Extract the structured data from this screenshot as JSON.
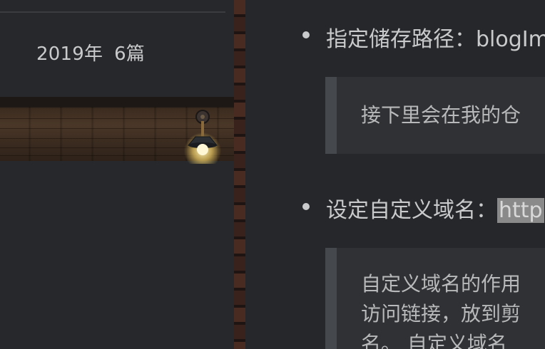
{
  "sidebar": {
    "archive": {
      "year_label": "2019年",
      "count_label": "6篇"
    }
  },
  "main": {
    "list_items": [
      {
        "label": "指定储存路径：",
        "value": "blogIm"
      },
      {
        "label": "设定自定义域名：",
        "value": "http"
      }
    ],
    "quotes": [
      {
        "lines": [
          "接下里会在我的仓"
        ]
      },
      {
        "lines": [
          "自定义域名的作用",
          "访问链接，放到剪",
          "名。 自定义域名"
        ]
      }
    ]
  },
  "colors": {
    "background": "#25272a",
    "text": "#c9cacb",
    "quote_bg": "#2f3134",
    "quote_border": "#45484c",
    "code_bg": "#8a8a8a"
  },
  "icons": [
    "wall-lamp-icon",
    "list-bullet-icon"
  ]
}
